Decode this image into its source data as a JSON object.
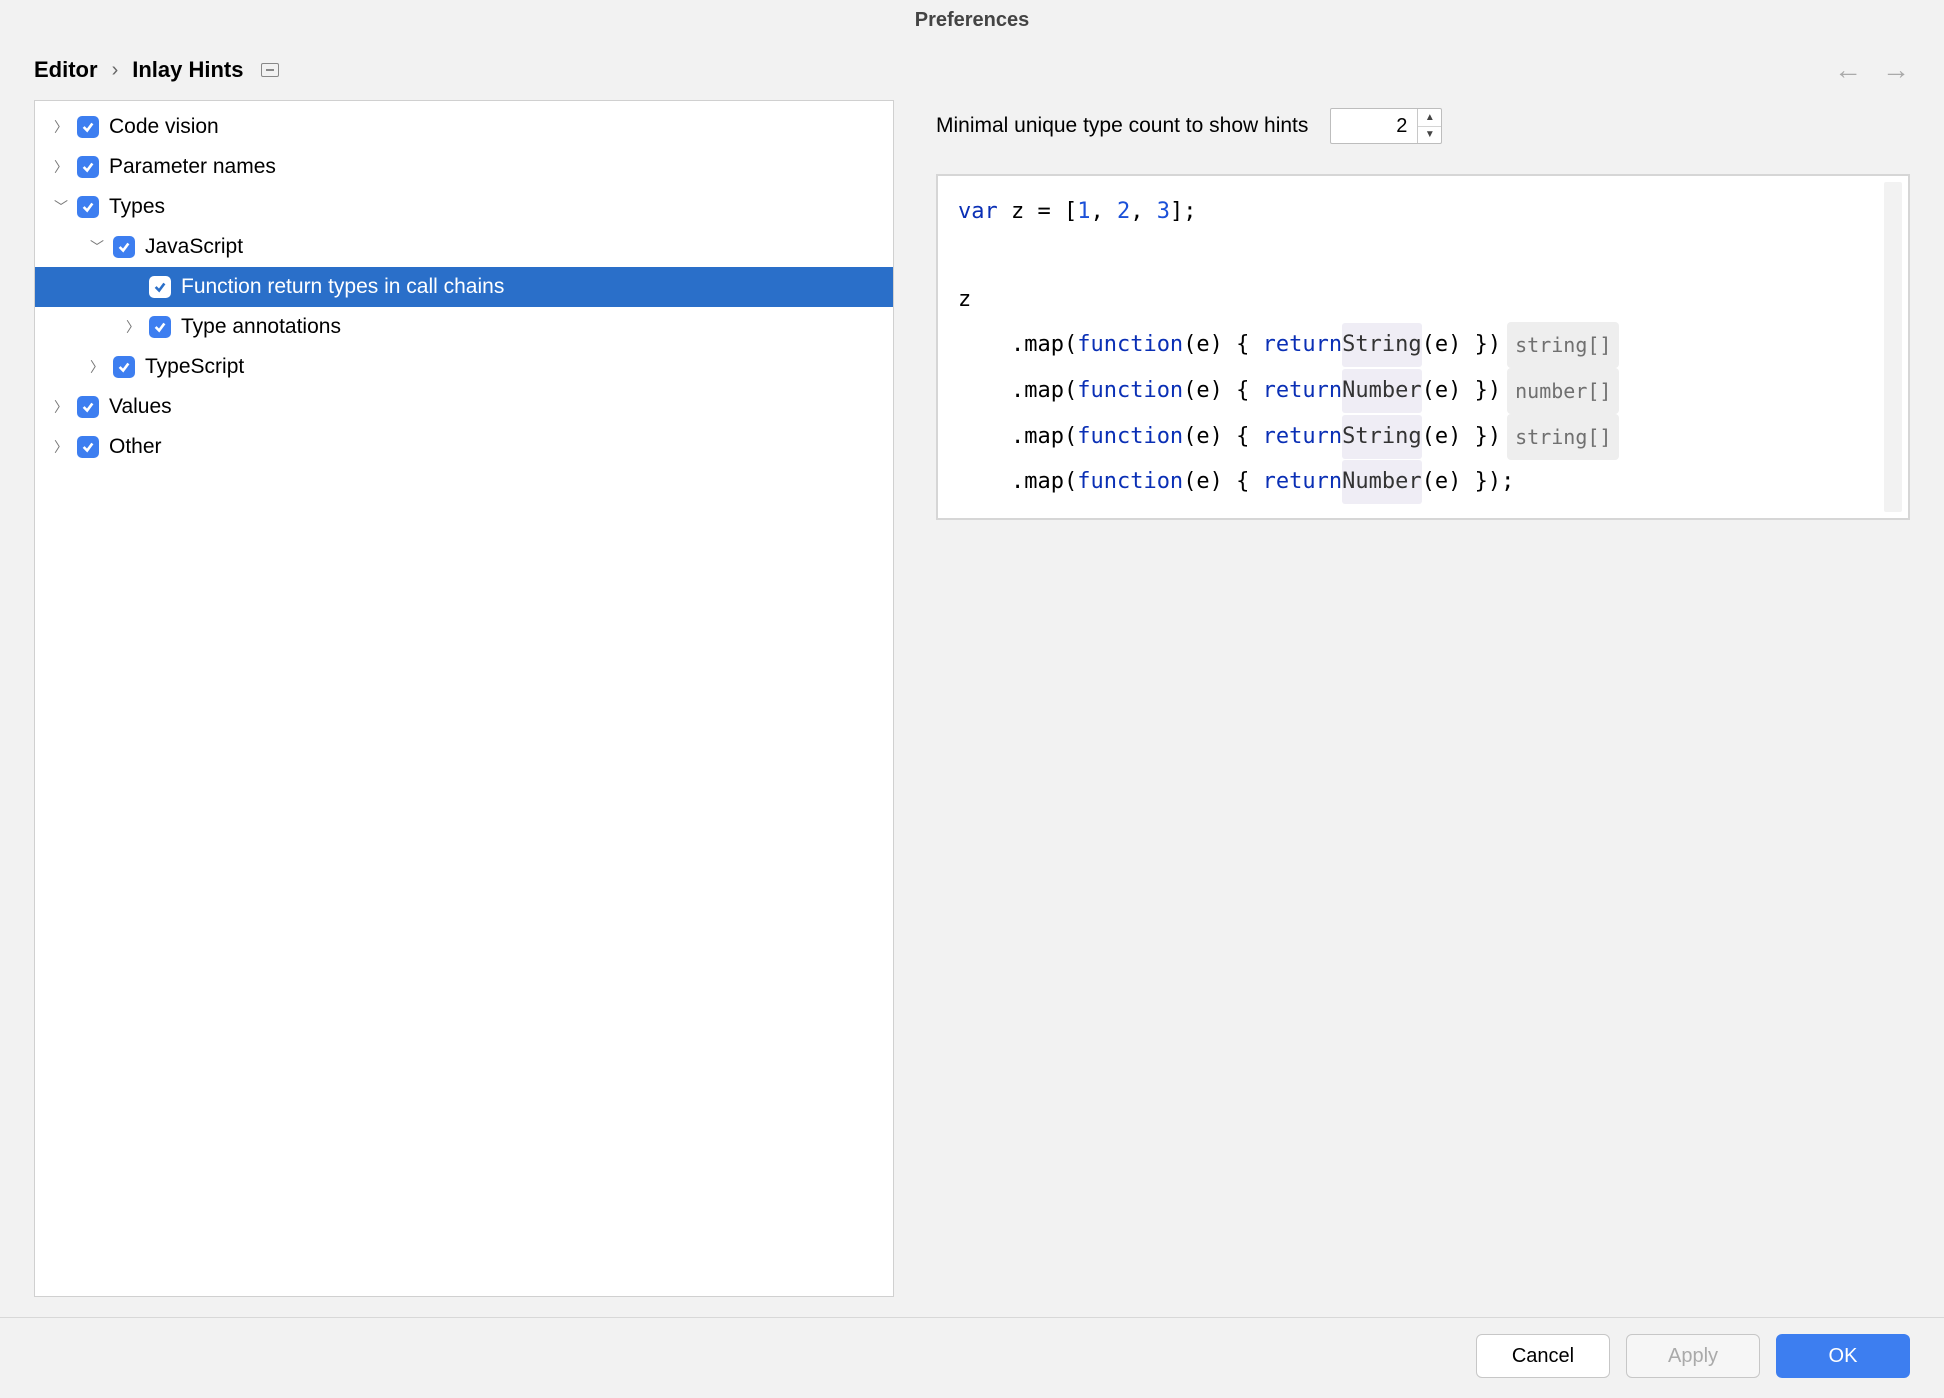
{
  "window_title": "Preferences",
  "breadcrumb": {
    "root": "Editor",
    "leaf": "Inlay Hints"
  },
  "nav": {
    "back": "←",
    "forward": "→"
  },
  "tree": [
    {
      "key": "code-vision",
      "label": "Code vision",
      "depth": 0,
      "arrow": "right",
      "checked": true
    },
    {
      "key": "parameter-names",
      "label": "Parameter names",
      "depth": 0,
      "arrow": "right",
      "checked": true
    },
    {
      "key": "types",
      "label": "Types",
      "depth": 0,
      "arrow": "down",
      "checked": true
    },
    {
      "key": "javascript",
      "label": "JavaScript",
      "depth": 1,
      "arrow": "down",
      "checked": true
    },
    {
      "key": "fn-return",
      "label": "Function return types in call chains",
      "depth": 2,
      "arrow": "none",
      "checked": true,
      "selected": true
    },
    {
      "key": "type-annot",
      "label": "Type annotations",
      "depth": 2,
      "arrow": "right",
      "checked": true
    },
    {
      "key": "typescript",
      "label": "TypeScript",
      "depth": 1,
      "arrow": "right",
      "checked": true
    },
    {
      "key": "values",
      "label": "Values",
      "depth": 0,
      "arrow": "right",
      "checked": true
    },
    {
      "key": "other",
      "label": "Other",
      "depth": 0,
      "arrow": "right",
      "checked": true
    }
  ],
  "setting": {
    "label": "Minimal unique type count to show hints",
    "value": "2"
  },
  "code": {
    "kw_var": "var",
    "var_name": "z",
    "array": [
      "1",
      "2",
      "3"
    ],
    "kw_function": "function",
    "kw_return": "return",
    "calls": [
      {
        "caller": "String",
        "hint": "string[]"
      },
      {
        "caller": "Number",
        "hint": "number[]"
      },
      {
        "caller": "String",
        "hint": "string[]"
      },
      {
        "caller": "Number",
        "hint": ""
      }
    ]
  },
  "buttons": {
    "cancel": "Cancel",
    "apply": "Apply",
    "ok": "OK"
  }
}
